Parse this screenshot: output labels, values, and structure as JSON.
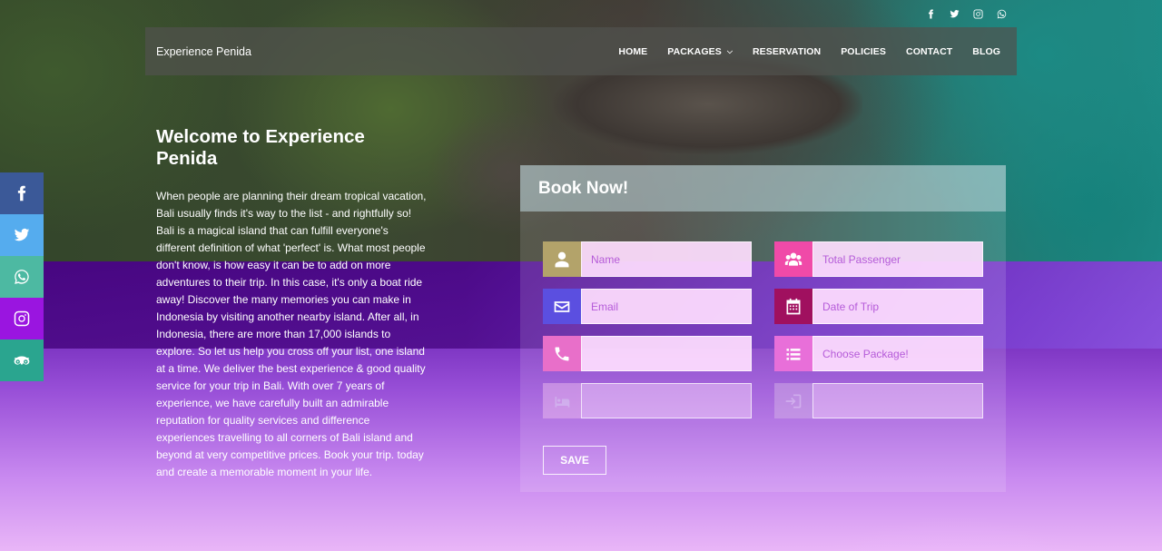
{
  "brand": "Experience Penida",
  "nav": {
    "home": "HOME",
    "packages": "PACKAGES",
    "reservation": "RESERVATION",
    "policies": "POLICIES",
    "contact": "CONTACT",
    "blog": "BLOG"
  },
  "top_social": [
    "facebook-icon",
    "twitter-icon",
    "instagram-icon",
    "whatsapp-icon"
  ],
  "side_social": [
    "facebook-icon",
    "twitter-icon",
    "whatsapp-icon",
    "instagram-icon",
    "tripadvisor-icon"
  ],
  "welcome": {
    "title": "Welcome to Experience Penida",
    "body": "When people are planning their dream tropical vacation, Bali usually finds it's way to the list - and rightfully so! Bali is a magical island that can fulfill everyone's different definition of what 'perfect' is. What most people don't know, is how easy it can be to add on more adventures to their trip. In this case, it's only a boat ride away! Discover the many memories you can make in Indonesia by visiting another nearby island. After all, in Indonesia, there are more than 17,000 islands to explore. So let us help you cross off your list, one island at a time. We deliver the best experience & good quality service for your trip in Bali. With over 7 years of experience, we have carefully built an admirable reputation for quality services and difference experiences travelling to all corners of Bali island and beyond at very competitive prices. Book your trip. today and create a memorable moment in your life."
  },
  "booking": {
    "title": "Book Now!",
    "save_label": "SAVE",
    "fields": {
      "name": "Name",
      "total_passenger": "Total Passenger",
      "email": "Email",
      "date_of_trip": "Date of Trip",
      "choose_package": "Choose Package!"
    }
  },
  "colors": {
    "facebook": "#3b5998",
    "twitter": "#55acee",
    "whatsapp": "#4db9a2",
    "instagram": "#9a15e0",
    "tripadvisor": "#2aa58f",
    "icon_name": "#b3a36a",
    "icon_email": "#5b4fe0",
    "icon_phone": "#e86fc9",
    "icon_passenger": "#f04aa8",
    "icon_date": "#a0105f",
    "icon_package": "#e86fd9"
  }
}
